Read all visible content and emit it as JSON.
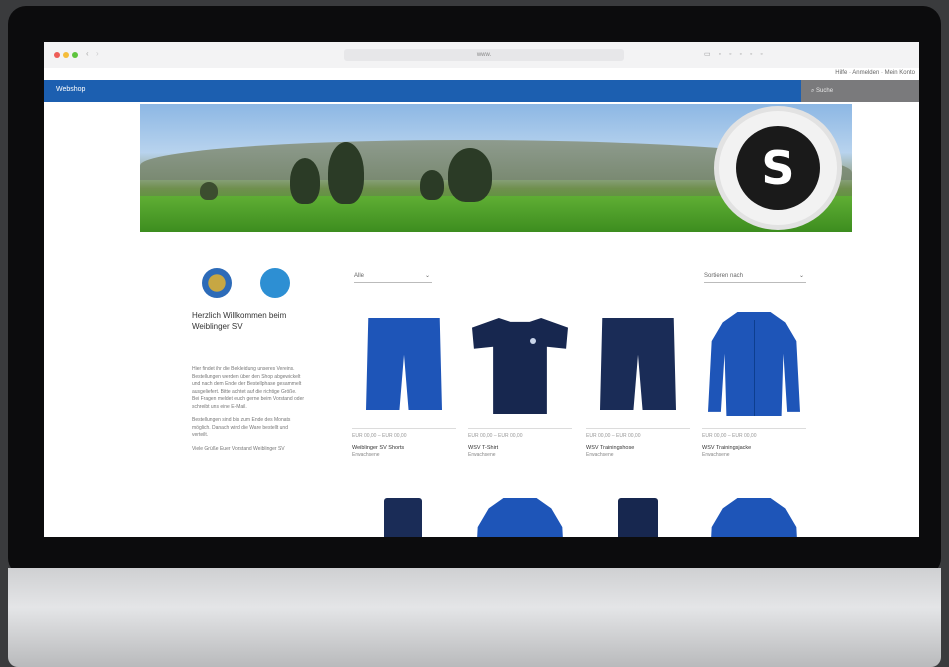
{
  "browser": {
    "url": "www.",
    "toolbar_icons": "▭ ◦ ◦ ◦ ◦ ◦",
    "subbar_right": "Hilfe · Anmelden · Mein Konto"
  },
  "site": {
    "brand": "Webshop",
    "search_placeholder": "Suche"
  },
  "banner": {
    "emblem_letter": "S"
  },
  "sidebar": {
    "title": "Herzlich Willkommen beim Weiblinger SV",
    "paragraph1": "Hier findet ihr die Bekleidung unseres Vereins. Bestellungen werden über den Shop abgewickelt und nach dem Ende der Bestellphase gesammelt ausgeliefert. Bitte achtet auf die richtige Größe. Bei Fragen meldet euch gerne beim Vorstand oder schreibt uns eine E-Mail.",
    "paragraph2": "Bestellungen sind bis zum Ende des Monats möglich. Danach wird die Ware bestellt und verteilt.",
    "paragraph3": "Viele Grüße Euer Vorstand Weiblinger SV"
  },
  "toolbar": {
    "filter_label": "Alle",
    "sort_label": "Sortieren nach"
  },
  "products": [
    {
      "price": "EUR 00,00 – EUR 00,00",
      "name": "Weiblinger SV Shorts",
      "sub": "Erwachsene"
    },
    {
      "price": "EUR 00,00 – EUR 00,00",
      "name": "WSV T-Shirt",
      "sub": "Erwachsene"
    },
    {
      "price": "EUR 00,00 – EUR 00,00",
      "name": "WSV Trainingshose",
      "sub": "Erwachsene"
    },
    {
      "price": "EUR 00,00 – EUR 00,00",
      "name": "WSV Trainingsjacke",
      "sub": "Erwachsene"
    }
  ],
  "colors": {
    "nav_blue": "#1c5fb0",
    "royal_blue": "#1e55b8",
    "navy": "#17274f"
  }
}
